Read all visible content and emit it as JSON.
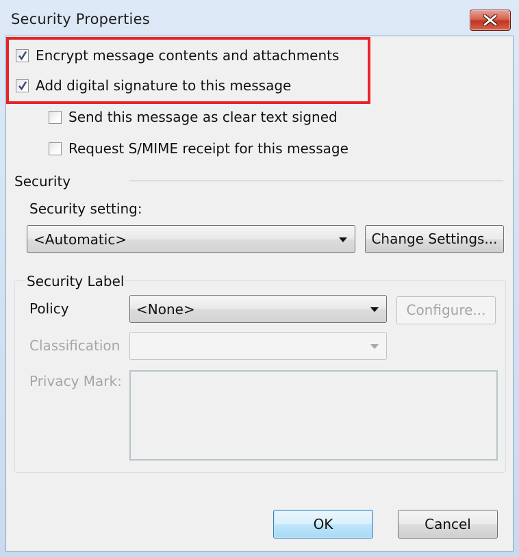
{
  "window": {
    "title": "Security Properties"
  },
  "options": {
    "encrypt": {
      "label": "Encrypt message contents and attachments",
      "checked": true
    },
    "sign": {
      "label": "Add digital signature to this message",
      "checked": true
    },
    "clear_text": {
      "label": "Send this message as clear text signed",
      "checked": false
    },
    "receipt": {
      "label": "Request S/MIME receipt for this message",
      "checked": false
    }
  },
  "security": {
    "section_label": "Security",
    "setting_label": "Security setting:",
    "setting_value": "<Automatic>",
    "change_settings_label": "Change Settings..."
  },
  "security_label": {
    "group_title": "Security Label",
    "policy_label": "Policy",
    "policy_value": "<None>",
    "configure_label": "Configure...",
    "classification_label": "Classification",
    "classification_value": "",
    "privacy_mark_label": "Privacy Mark:"
  },
  "footer": {
    "ok_label": "OK",
    "cancel_label": "Cancel"
  },
  "colors": {
    "highlight": "#e8242a",
    "close_button": "#c7432c"
  }
}
